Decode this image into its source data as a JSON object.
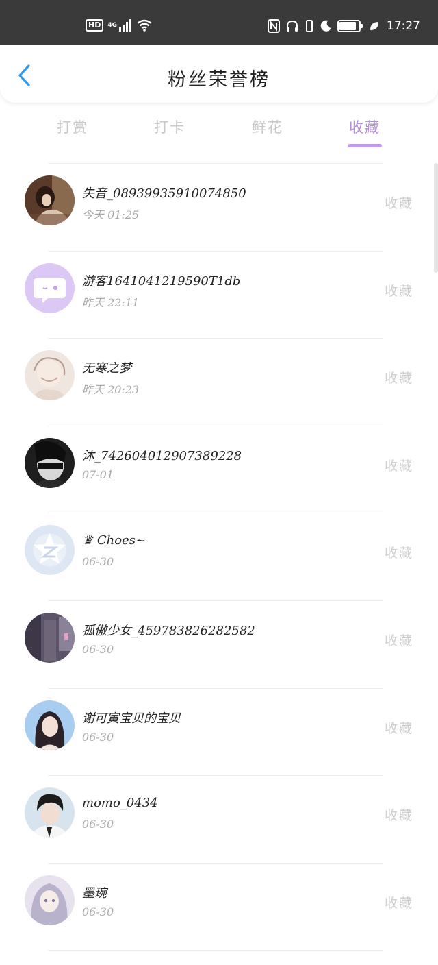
{
  "status_bar": {
    "hd": "HD",
    "network": "4G",
    "battery": "84",
    "time": "17:27"
  },
  "header": {
    "title": "粉丝荣誉榜"
  },
  "tabs": [
    {
      "label": "打赏",
      "active": false
    },
    {
      "label": "打卡",
      "active": false
    },
    {
      "label": "鲜花",
      "active": false
    },
    {
      "label": "收藏",
      "active": true
    }
  ],
  "rows": [
    {
      "name": "失音_0893993591007485​0",
      "time": "今天 01:25",
      "action": "收藏",
      "avatar": "avatar-1"
    },
    {
      "name": "游客1641041219590T1db",
      "time": "昨天 22:11",
      "action": "收藏",
      "avatar": "avatar-default"
    },
    {
      "name": "无寒之梦",
      "time": "昨天 20:23",
      "action": "收藏",
      "avatar": "avatar-3"
    },
    {
      "name": "沐_7426040129073​89228",
      "time": "07-01",
      "action": "收藏",
      "avatar": "avatar-4"
    },
    {
      "name": "♛ Choes~",
      "time": "06-30",
      "action": "收藏",
      "avatar": "avatar-qq"
    },
    {
      "name": "孤傲少女_4597838262825​82",
      "time": "06-30",
      "action": "收藏",
      "avatar": "avatar-6"
    },
    {
      "name": "谢可寅宝贝的宝贝",
      "time": "06-30",
      "action": "收藏",
      "avatar": "avatar-7"
    },
    {
      "name": "momo_0434",
      "time": "06-30",
      "action": "收藏",
      "avatar": "avatar-8"
    },
    {
      "name": "墨琬",
      "time": "06-30",
      "action": "收藏",
      "avatar": "avatar-9"
    }
  ],
  "colors": {
    "accent": "#b68fd8",
    "status_bar": "#3a3a3a",
    "back_arrow": "#2c9cf0"
  }
}
